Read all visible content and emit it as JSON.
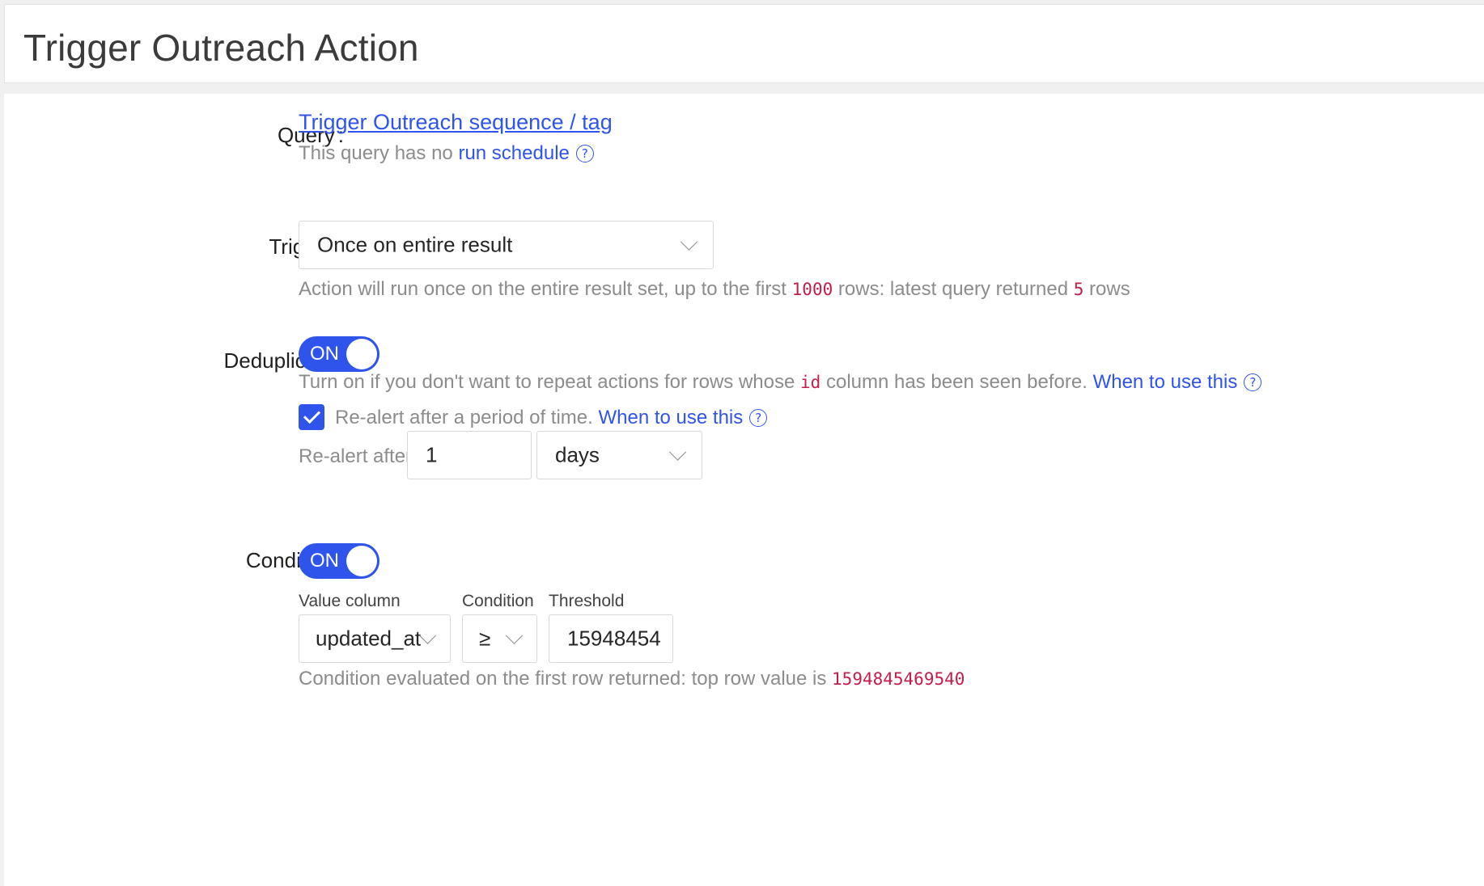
{
  "header": {
    "title": "Trigger Outreach Action"
  },
  "query": {
    "label": "Query",
    "link_text": "Trigger Outreach sequence / tag",
    "schedule_prefix": "This query has no",
    "schedule_link": "run schedule"
  },
  "trigger": {
    "label": "Trigger",
    "selected": "Once on entire result",
    "help_prefix": "Action will run once on the entire result set, up to the first",
    "max_rows": "1000",
    "help_middle": "rows: latest query returned",
    "returned_rows": "5",
    "help_suffix": "rows"
  },
  "deduplicate": {
    "label": "Deduplicate",
    "toggle_label": "ON",
    "enabled": true,
    "help_prefix": "Turn on if you don't want to repeat actions for rows whose",
    "column": "id",
    "help_suffix": "column has been seen before.",
    "help_link": "When to use this",
    "realert_checked": true,
    "realert_text": "Re-alert after a period of time.",
    "realert_link": "When to use this",
    "realert_after_label": "Re-alert after",
    "realert_value": "1",
    "realert_unit": "days"
  },
  "condition": {
    "label": "Condition",
    "toggle_label": "ON",
    "enabled": true,
    "value_column_label": "Value column",
    "value_column": "updated_at",
    "condition_label": "Condition",
    "operator": "≥",
    "threshold_label": "Threshold",
    "threshold": "15948454",
    "help_prefix": "Condition evaluated on the first row returned: top row value is",
    "top_row_value": "1594845469540"
  },
  "colors": {
    "accent": "#2f54eb",
    "code": "#c41d4a",
    "muted": "#8c8c8c"
  },
  "icons": {
    "help": "question-circle-icon",
    "dropdown": "chevron-down-icon",
    "check": "check-icon"
  }
}
